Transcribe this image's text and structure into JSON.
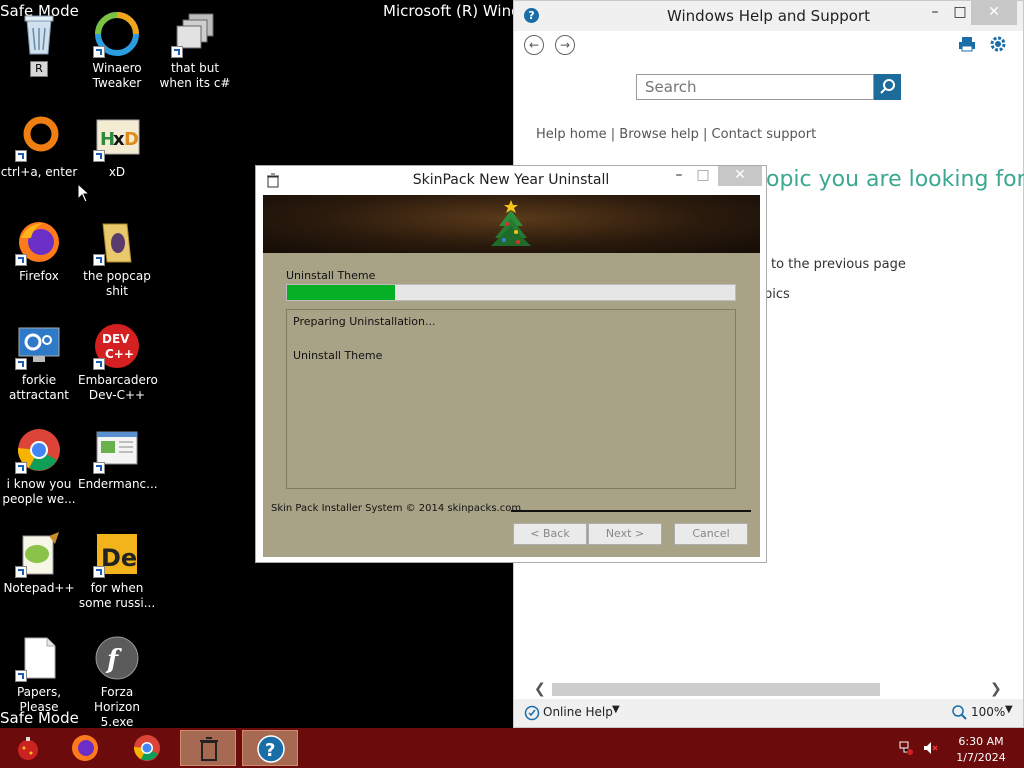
{
  "desktop": {
    "top_left_text": "Safe Mode",
    "top_center_text": "Microsoft (R) Windo",
    "bottom_left_text": "Safe Mode",
    "icons": [
      {
        "label": "R",
        "icon": "recycle-bin-icon"
      },
      {
        "label": "Winaero Tweaker",
        "icon": "winaero-icon"
      },
      {
        "label": "that but when its c#",
        "icon": "windows-stack-icon"
      },
      {
        "label": "ctrl+a, enter",
        "icon": "orange-ring-icon"
      },
      {
        "label": "xD",
        "icon": "hxd-icon"
      },
      {
        "label": "Firefox",
        "icon": "firefox-icon"
      },
      {
        "label": "the popcap shit",
        "icon": "folder-icon"
      },
      {
        "label": "forkie attractant",
        "icon": "monitor-gear-icon"
      },
      {
        "label": "Embarcadero Dev-C++",
        "icon": "devcpp-icon"
      },
      {
        "label": "i know you people we...",
        "icon": "chrome-icon"
      },
      {
        "label": "Endermanc...",
        "icon": "app-window-icon"
      },
      {
        "label": "Notepad++",
        "icon": "notepadpp-icon"
      },
      {
        "label": "for when some russi...",
        "icon": "de-icon"
      },
      {
        "label": "Papers, Please",
        "icon": "blank-document-icon"
      },
      {
        "label": "Forza Horizon 5.exe",
        "icon": "flash-icon"
      }
    ]
  },
  "help_window": {
    "title": "Windows Help and Support",
    "search_placeholder": "Search",
    "link_help_home": "Help home",
    "link_browse_help": "Browse help",
    "link_contact_support": "Contact support",
    "separator": "|",
    "heading_fragment": "opic you are looking for",
    "line_fragment_1": "to the previous page",
    "line_fragment_2": "pics",
    "online_help": "Online Help",
    "zoom": "100%"
  },
  "uninstall_dialog": {
    "title": "SkinPack New Year Uninstall",
    "progress_label": "Uninstall Theme",
    "progress_fraction": 0.24,
    "log_lines": [
      "Preparing Uninstallation...",
      "Uninstall Theme"
    ],
    "brand_text": "Skin Pack Installer System © 2014 skinpacks.com",
    "back_button": "< Back",
    "next_button": "Next >",
    "cancel_button": "Cancel"
  },
  "taskbar": {
    "time": "6:30 AM",
    "date": "1/7/2024"
  },
  "colors": {
    "taskbar": "#6b0b0b",
    "dialog_body": "#a8a387",
    "progress_fill": "#06b025",
    "help_accent": "#3ba890"
  }
}
